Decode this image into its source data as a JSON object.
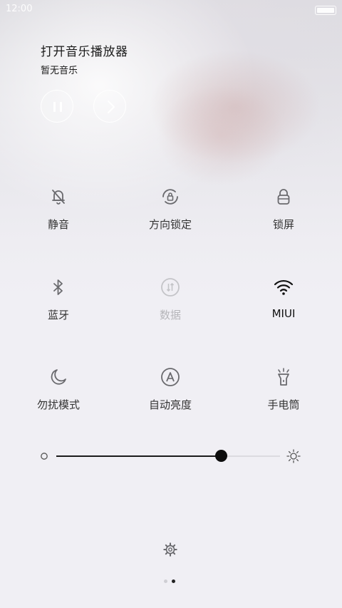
{
  "status_bar": {
    "time": "12:00"
  },
  "music": {
    "title": "打开音乐播放器",
    "subtitle": "暂无音乐"
  },
  "tiles": [
    {
      "label": "静音",
      "icon": "bell-off-icon",
      "state": "off"
    },
    {
      "label": "方向锁定",
      "icon": "rotation-lock-icon",
      "state": "off"
    },
    {
      "label": "锁屏",
      "icon": "lock-icon",
      "state": "off"
    },
    {
      "label": "蓝牙",
      "icon": "bluetooth-icon",
      "state": "off"
    },
    {
      "label": "数据",
      "icon": "mobile-data-icon",
      "state": "disabled"
    },
    {
      "label": "MIUI",
      "icon": "wifi-icon",
      "state": "on"
    },
    {
      "label": "勿扰模式",
      "icon": "moon-icon",
      "state": "off"
    },
    {
      "label": "自动亮度",
      "icon": "auto-brightness-icon",
      "state": "off"
    },
    {
      "label": "手电筒",
      "icon": "flashlight-icon",
      "state": "off"
    }
  ],
  "brightness": {
    "level_fraction": 0.74
  },
  "pager": {
    "pages": 2,
    "current": 2
  },
  "colors": {
    "background": "#f0eff4",
    "icon": "#5a5a5e",
    "icon_disabled": "#b6b6ba",
    "active": "#111111"
  }
}
